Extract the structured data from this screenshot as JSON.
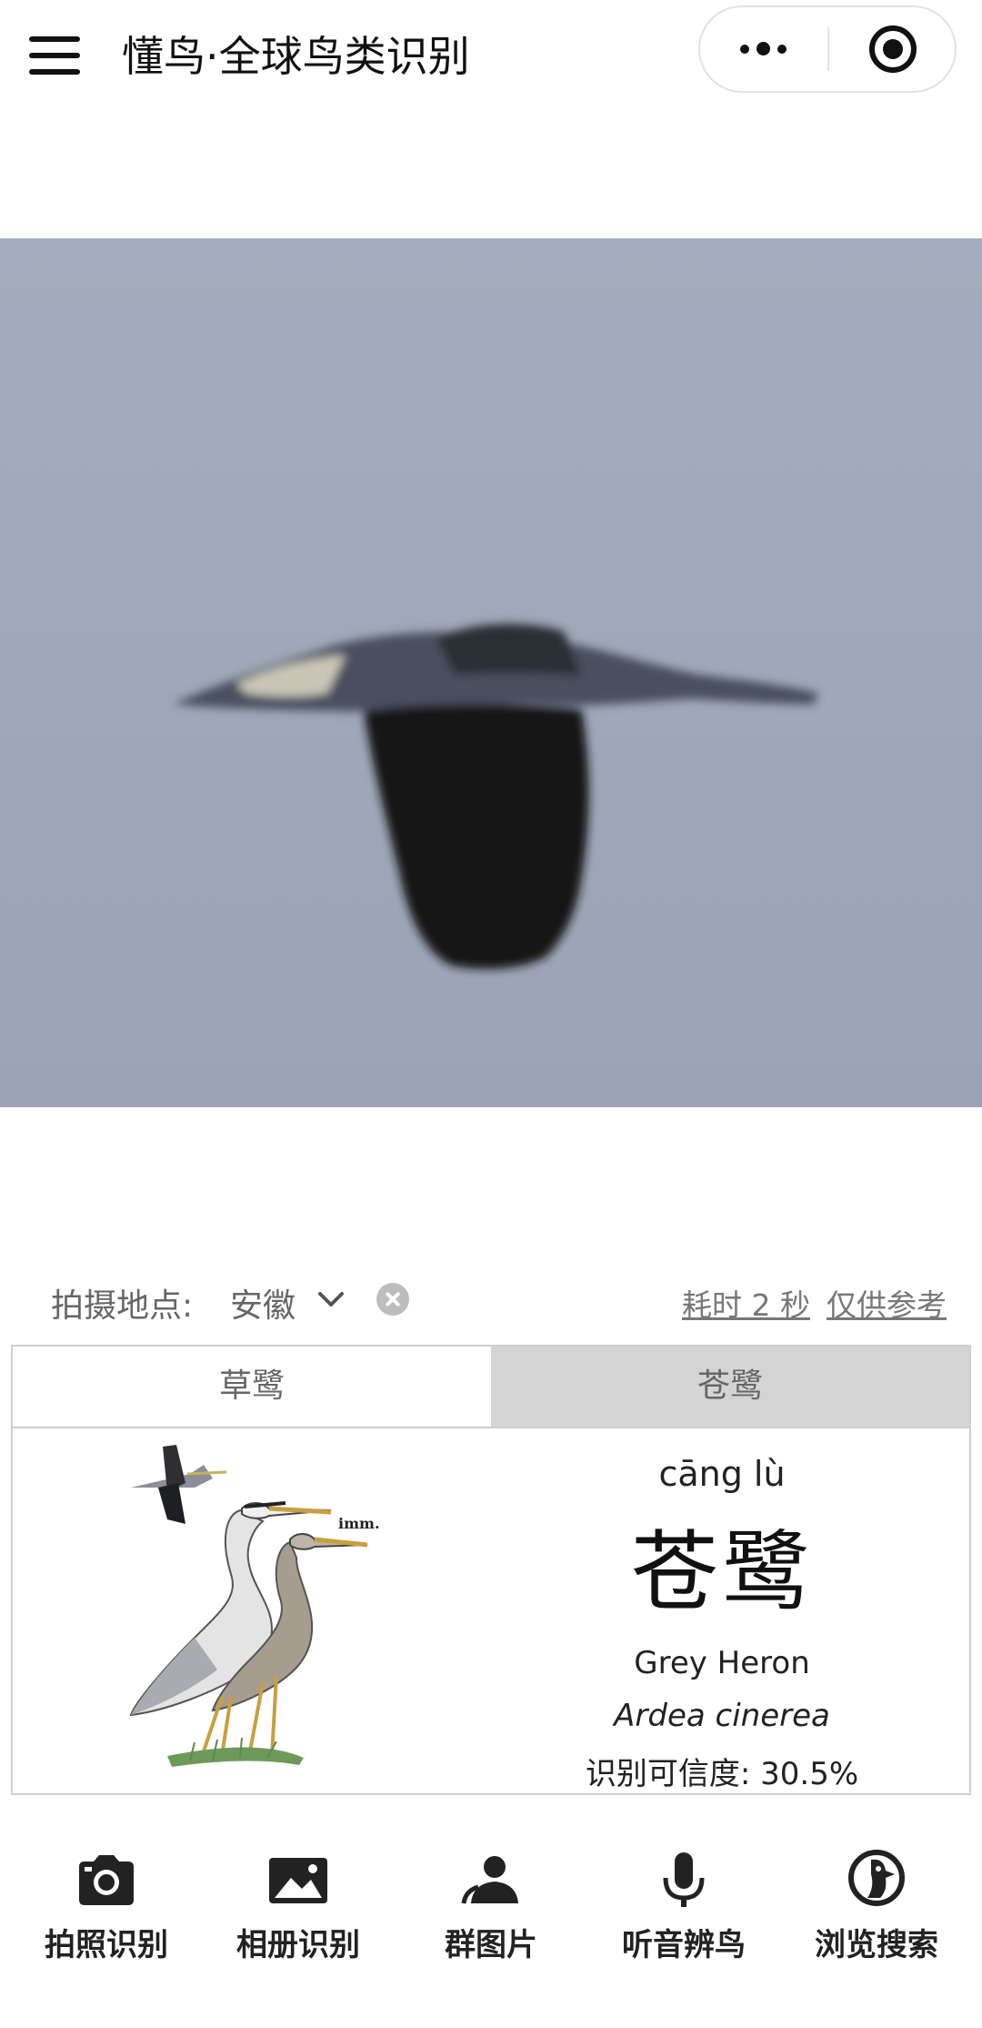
{
  "header": {
    "title": "懂鸟·全球鸟类识别",
    "menu_icon": "hamburger-icon",
    "more_icon": "more-dots-icon",
    "close_icon": "target-circle-icon"
  },
  "photo": {
    "subject": "bird-photo"
  },
  "location": {
    "label": "拍摄地点:",
    "value": "安徽",
    "time_text": "耗时 2 秒",
    "ref_text": "仅供参考"
  },
  "result": {
    "tabs": [
      {
        "label": "草鹭",
        "selected": false
      },
      {
        "label": "苍鹭",
        "selected": true
      }
    ],
    "pinyin": "cāng lù",
    "name_cn": "苍鹭",
    "name_en": "Grey Heron",
    "name_sci": "Ardea cinerea",
    "confidence": "识别可信度:  30.5%",
    "illustration_tag": "imm."
  },
  "bottom_nav": [
    {
      "label": "拍照识别",
      "icon": "camera-icon"
    },
    {
      "label": "相册识别",
      "icon": "image-icon"
    },
    {
      "label": "群图片",
      "icon": "group-icon"
    },
    {
      "label": "听音辨鸟",
      "icon": "microphone-icon"
    },
    {
      "label": "浏览搜索",
      "icon": "search-bird-icon"
    }
  ],
  "colors": {
    "tab_selected_bg": "#d4d4d4",
    "sky": "#9ea7b8",
    "text_muted": "#666666"
  }
}
